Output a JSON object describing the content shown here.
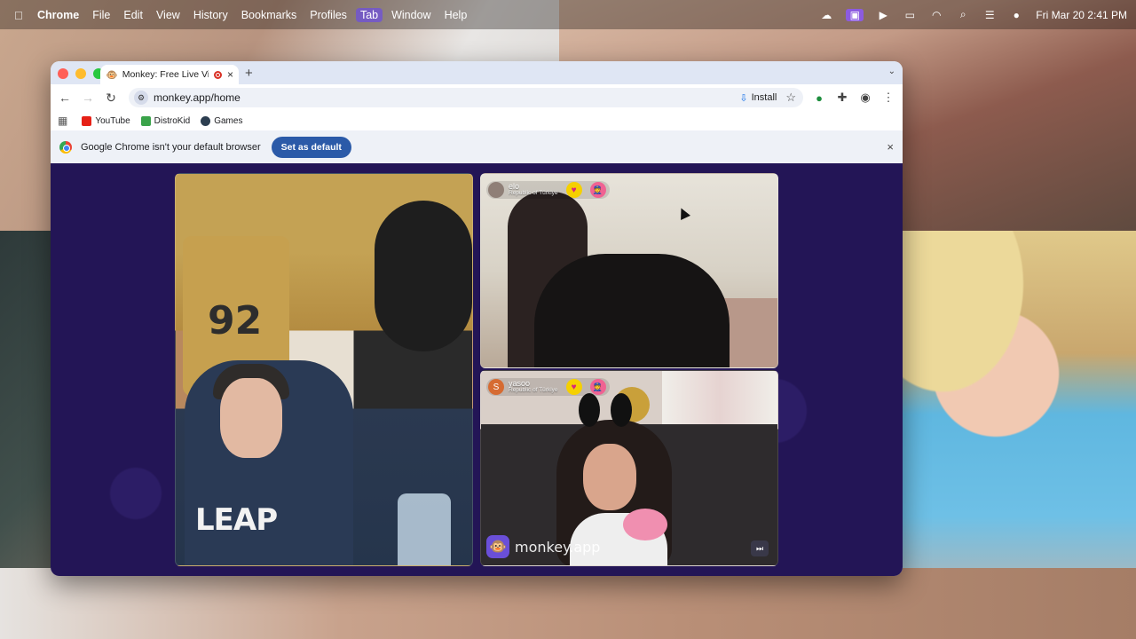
{
  "menubar": {
    "apple_icon": "apple-icon",
    "app_name": "Chrome",
    "menus": [
      "File",
      "Edit",
      "View",
      "History",
      "Bookmarks",
      "Profiles",
      "Tab",
      "Window",
      "Help"
    ],
    "active_menu": "Tab",
    "clock": "Fri Mar 20  2:41 PM",
    "status_icons": [
      "creative-cloud-icon",
      "screen-record-icon",
      "play-icon",
      "battery-icon",
      "wifi-icon",
      "spotlight-icon",
      "control-center-icon",
      "siri-icon"
    ]
  },
  "browser": {
    "tab": {
      "title": "Monkey: Free Live Video Chat",
      "favicon": "🐵",
      "close_label": "×"
    },
    "new_tab_label": "+",
    "tab_menu_label": "⌄",
    "address": {
      "url": "monkey.app/home",
      "install_label": "Install"
    },
    "bookmarks": [
      {
        "label": "YouTube"
      },
      {
        "label": "DistroKid"
      },
      {
        "label": "Games"
      }
    ],
    "infobar": {
      "message": "Google Chrome isn't your default browser",
      "button": "Set as default",
      "close_label": "×"
    }
  },
  "chat": {
    "participants": [
      {
        "username": "elo",
        "country": "Republic of Türkiye",
        "avatar": ""
      },
      {
        "username": "yasoo",
        "country": "Republic of Türkiye",
        "avatar": "S"
      }
    ],
    "heart_icon": "♥",
    "mod_icon": "👮",
    "brand": "monkey.app",
    "brand_logo": "🐵",
    "skip_label": "⏭"
  }
}
